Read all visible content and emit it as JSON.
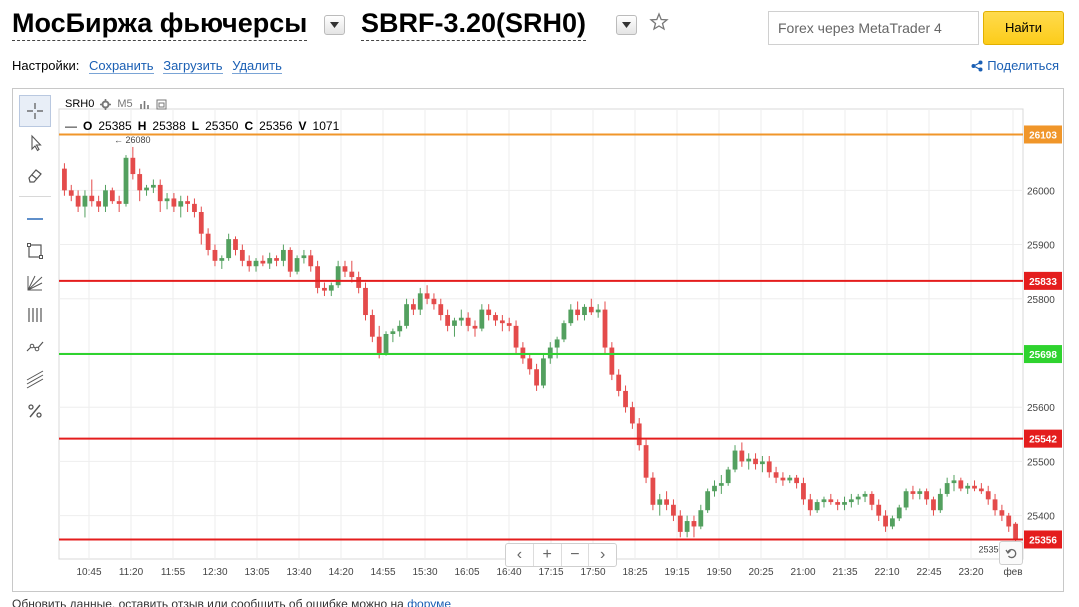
{
  "header": {
    "exchange_title": "МосБиржа фьючерсы",
    "ticker_title": "SBRF-3.20(SRH0)",
    "search_placeholder": "Forex через MetaTrader 4",
    "search_button": "Найти"
  },
  "settings": {
    "label": "Настройки:",
    "save": "Сохранить",
    "load": "Загрузить",
    "delete": "Удалить",
    "share": "Поделиться"
  },
  "legend": {
    "symbol": "SRH0",
    "timeframe": "M5",
    "o_label": "O",
    "o": "25385",
    "h_label": "H",
    "h": "25388",
    "l_label": "L",
    "l": "25350",
    "c_label": "C",
    "c": "25356",
    "v_label": "V",
    "v": "1071"
  },
  "footer": {
    "text": "Обновить данные, оставить отзыв или сообщить об ошибке можно на",
    "link": "форуме"
  },
  "colors": {
    "up": "#53a05f",
    "down": "#e44b4b",
    "orange": "#f0962a",
    "red": "#e41d1d",
    "green": "#2fd32f",
    "accent": "#1a5fb4"
  },
  "chart_data": {
    "type": "candlestick",
    "ylim": [
      25320,
      26150
    ],
    "y_ticks": [
      25400,
      25500,
      25600,
      25700,
      25800,
      25900,
      26000
    ],
    "x_tick_labels": [
      "10:45",
      "11:20",
      "11:55",
      "12:30",
      "13:05",
      "13:40",
      "14:20",
      "14:55",
      "15:30",
      "16:05",
      "16:40",
      "17:15",
      "17:50",
      "18:25",
      "19:15",
      "19:50",
      "20:25",
      "21:00",
      "21:35",
      "22:10",
      "22:45",
      "23:20",
      "фев"
    ],
    "horizontal_lines": [
      {
        "value": 26103,
        "label": "26103",
        "color": "#f0962a"
      },
      {
        "value": 25833,
        "label": "25833",
        "color": "#e41d1d"
      },
      {
        "value": 25698,
        "label": "25698",
        "color": "#2fd32f"
      },
      {
        "value": 25542,
        "label": "25542",
        "color": "#e41d1d"
      },
      {
        "value": 25356,
        "label": "25356",
        "color": "#e41d1d"
      }
    ],
    "annotations": [
      {
        "text": "← 26080",
        "value": 26080
      },
      {
        "text": "25350 →",
        "value": 25350
      }
    ],
    "candles": [
      [
        26040,
        26050,
        25990,
        26000
      ],
      [
        26000,
        26010,
        25980,
        25990
      ],
      [
        25990,
        26000,
        25960,
        25970
      ],
      [
        25970,
        26000,
        25950,
        25990
      ],
      [
        25990,
        26020,
        25970,
        25980
      ],
      [
        25980,
        25990,
        25960,
        25970
      ],
      [
        25970,
        26010,
        25960,
        26000
      ],
      [
        26000,
        26005,
        25975,
        25980
      ],
      [
        25980,
        25990,
        25960,
        25975
      ],
      [
        25975,
        26065,
        25970,
        26060
      ],
      [
        26060,
        26080,
        26020,
        26030
      ],
      [
        26030,
        26040,
        25980,
        26000
      ],
      [
        26000,
        26010,
        25990,
        26005
      ],
      [
        26005,
        26020,
        25995,
        26010
      ],
      [
        26010,
        26020,
        25960,
        25980
      ],
      [
        25980,
        25995,
        25965,
        25985
      ],
      [
        25985,
        25995,
        25960,
        25970
      ],
      [
        25970,
        25990,
        25950,
        25980
      ],
      [
        25980,
        25990,
        25960,
        25975
      ],
      [
        25975,
        25985,
        25950,
        25960
      ],
      [
        25960,
        25970,
        25900,
        25920
      ],
      [
        25920,
        25930,
        25880,
        25890
      ],
      [
        25890,
        25900,
        25860,
        25870
      ],
      [
        25870,
        25880,
        25855,
        25875
      ],
      [
        25875,
        25920,
        25870,
        25910
      ],
      [
        25910,
        25915,
        25880,
        25890
      ],
      [
        25890,
        25900,
        25860,
        25870
      ],
      [
        25870,
        25880,
        25850,
        25860
      ],
      [
        25860,
        25875,
        25850,
        25870
      ],
      [
        25870,
        25880,
        25860,
        25865
      ],
      [
        25865,
        25885,
        25855,
        25875
      ],
      [
        25875,
        25880,
        25860,
        25870
      ],
      [
        25870,
        25900,
        25860,
        25890
      ],
      [
        25890,
        25895,
        25840,
        25850
      ],
      [
        25850,
        25880,
        25845,
        25875
      ],
      [
        25875,
        25890,
        25865,
        25880
      ],
      [
        25880,
        25890,
        25850,
        25860
      ],
      [
        25860,
        25870,
        25810,
        25820
      ],
      [
        25820,
        25830,
        25805,
        25815
      ],
      [
        25815,
        25830,
        25805,
        25825
      ],
      [
        25825,
        25870,
        25820,
        25860
      ],
      [
        25860,
        25870,
        25840,
        25850
      ],
      [
        25850,
        25870,
        25830,
        25840
      ],
      [
        25840,
        25850,
        25810,
        25820
      ],
      [
        25820,
        25830,
        25760,
        25770
      ],
      [
        25770,
        25780,
        25720,
        25730
      ],
      [
        25730,
        25750,
        25690,
        25700
      ],
      [
        25700,
        25740,
        25695,
        25735
      ],
      [
        25735,
        25745,
        25720,
        25740
      ],
      [
        25740,
        25760,
        25730,
        25750
      ],
      [
        25750,
        25800,
        25745,
        25790
      ],
      [
        25790,
        25800,
        25770,
        25780
      ],
      [
        25780,
        25820,
        25770,
        25810
      ],
      [
        25810,
        25825,
        25790,
        25800
      ],
      [
        25800,
        25810,
        25780,
        25790
      ],
      [
        25790,
        25800,
        25760,
        25770
      ],
      [
        25770,
        25780,
        25740,
        25750
      ],
      [
        25750,
        25765,
        25730,
        25760
      ],
      [
        25760,
        25780,
        25750,
        25765
      ],
      [
        25765,
        25775,
        25740,
        25750
      ],
      [
        25750,
        25760,
        25730,
        25745
      ],
      [
        25745,
        25790,
        25740,
        25780
      ],
      [
        25780,
        25790,
        25760,
        25770
      ],
      [
        25770,
        25775,
        25750,
        25760
      ],
      [
        25760,
        25770,
        25740,
        25755
      ],
      [
        25755,
        25765,
        25740,
        25750
      ],
      [
        25750,
        25760,
        25700,
        25710
      ],
      [
        25710,
        25720,
        25680,
        25690
      ],
      [
        25690,
        25700,
        25660,
        25670
      ],
      [
        25670,
        25680,
        25630,
        25640
      ],
      [
        25640,
        25700,
        25635,
        25690
      ],
      [
        25690,
        25720,
        25680,
        25710
      ],
      [
        25710,
        25730,
        25690,
        25725
      ],
      [
        25725,
        25760,
        25720,
        25755
      ],
      [
        25755,
        25790,
        25750,
        25780
      ],
      [
        25780,
        25795,
        25760,
        25770
      ],
      [
        25770,
        25790,
        25760,
        25785
      ],
      [
        25785,
        25800,
        25770,
        25775
      ],
      [
        25775,
        25790,
        25765,
        25780
      ],
      [
        25780,
        25795,
        25700,
        25710
      ],
      [
        25710,
        25720,
        25650,
        25660
      ],
      [
        25660,
        25670,
        25620,
        25630
      ],
      [
        25630,
        25640,
        25590,
        25600
      ],
      [
        25600,
        25610,
        25560,
        25570
      ],
      [
        25570,
        25580,
        25520,
        25530
      ],
      [
        25530,
        25540,
        25460,
        25470
      ],
      [
        25470,
        25480,
        25410,
        25420
      ],
      [
        25420,
        25440,
        25400,
        25430
      ],
      [
        25430,
        25445,
        25410,
        25420
      ],
      [
        25420,
        25430,
        25390,
        25400
      ],
      [
        25400,
        25410,
        25360,
        25370
      ],
      [
        25370,
        25400,
        25360,
        25390
      ],
      [
        25390,
        25400,
        25360,
        25380
      ],
      [
        25380,
        25420,
        25375,
        25410
      ],
      [
        25410,
        25450,
        25405,
        25445
      ],
      [
        25445,
        25465,
        25435,
        25455
      ],
      [
        25455,
        25475,
        25440,
        25460
      ],
      [
        25460,
        25490,
        25455,
        25485
      ],
      [
        25485,
        25530,
        25480,
        25520
      ],
      [
        25520,
        25535,
        25490,
        25500
      ],
      [
        25500,
        25515,
        25485,
        25505
      ],
      [
        25505,
        25515,
        25485,
        25495
      ],
      [
        25495,
        25510,
        25480,
        25500
      ],
      [
        25500,
        25510,
        25470,
        25480
      ],
      [
        25480,
        25490,
        25460,
        25470
      ],
      [
        25470,
        25480,
        25455,
        25465
      ],
      [
        25465,
        25475,
        25460,
        25470
      ],
      [
        25470,
        25475,
        25450,
        25460
      ],
      [
        25460,
        25470,
        25420,
        25430
      ],
      [
        25430,
        25440,
        25400,
        25410
      ],
      [
        25410,
        25430,
        25405,
        25425
      ],
      [
        25425,
        25435,
        25415,
        25430
      ],
      [
        25430,
        25440,
        25420,
        25425
      ],
      [
        25425,
        25430,
        25410,
        25420
      ],
      [
        25420,
        25435,
        25410,
        25425
      ],
      [
        25425,
        25440,
        25415,
        25430
      ],
      [
        25430,
        25440,
        25420,
        25435
      ],
      [
        25435,
        25445,
        25425,
        25440
      ],
      [
        25440,
        25445,
        25410,
        25420
      ],
      [
        25420,
        25430,
        25390,
        25400
      ],
      [
        25400,
        25410,
        25370,
        25380
      ],
      [
        25380,
        25400,
        25375,
        25395
      ],
      [
        25395,
        25420,
        25390,
        25415
      ],
      [
        25415,
        25450,
        25410,
        25445
      ],
      [
        25445,
        25455,
        25430,
        25440
      ],
      [
        25440,
        25450,
        25430,
        25445
      ],
      [
        25445,
        25450,
        25420,
        25430
      ],
      [
        25430,
        25435,
        25400,
        25410
      ],
      [
        25410,
        25450,
        25405,
        25440
      ],
      [
        25440,
        25470,
        25435,
        25460
      ],
      [
        25460,
        25475,
        25445,
        25465
      ],
      [
        25465,
        25470,
        25445,
        25450
      ],
      [
        25450,
        25460,
        25440,
        25455
      ],
      [
        25455,
        25465,
        25445,
        25450
      ],
      [
        25450,
        25460,
        25440,
        25445
      ],
      [
        25445,
        25455,
        25420,
        25430
      ],
      [
        25430,
        25440,
        25400,
        25410
      ],
      [
        25410,
        25420,
        25390,
        25400
      ],
      [
        25400,
        25405,
        25370,
        25380
      ],
      [
        25385,
        25388,
        25350,
        25356
      ]
    ]
  }
}
